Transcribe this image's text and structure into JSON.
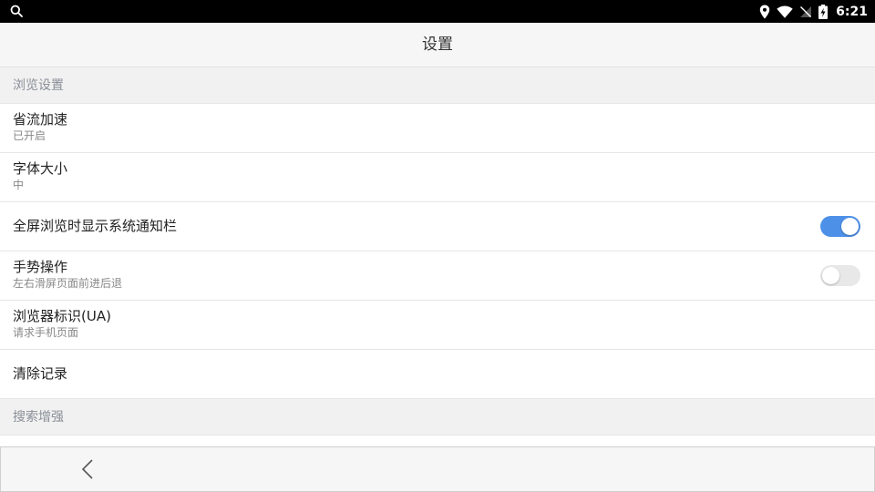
{
  "status_bar": {
    "time": "6:21",
    "icons": [
      "search-icon",
      "location-icon",
      "wifi-icon",
      "no-sim-icon",
      "battery-charging-icon"
    ]
  },
  "header": {
    "title": "设置"
  },
  "sections": [
    {
      "title": "浏览设置",
      "items": [
        {
          "title": "省流加速",
          "subtitle": "已开启"
        },
        {
          "title": "字体大小",
          "subtitle": "中"
        },
        {
          "title": "全屏浏览时显示系统通知栏",
          "toggle": true
        },
        {
          "title": "手势操作",
          "subtitle": "左右滑屏页面前进后退",
          "toggle": false
        },
        {
          "title": "浏览器标识(UA)",
          "subtitle": "请求手机页面"
        },
        {
          "title": "清除记录"
        }
      ]
    },
    {
      "title": "搜索增强",
      "items": []
    }
  ],
  "bottom_bar": {
    "back_icon": "chevron-left-icon"
  },
  "colors": {
    "toggle_on": "#4d90e8",
    "toggle_off": "#e8e8e8",
    "section_text": "#8a8f98"
  }
}
